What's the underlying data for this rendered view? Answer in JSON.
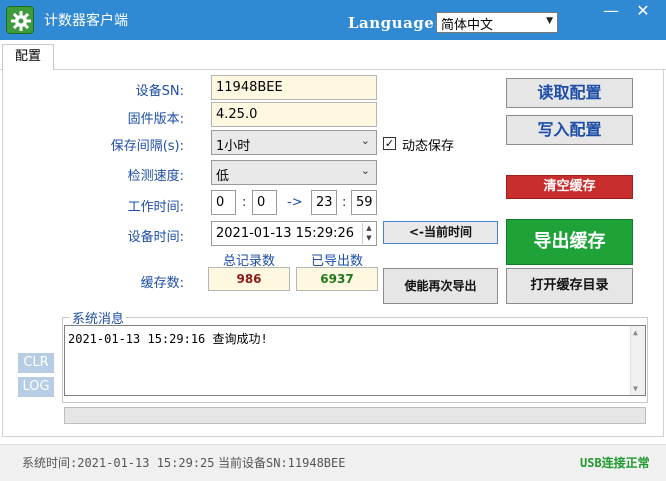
{
  "window": {
    "title": "计数器客户端",
    "language_label": "Language:",
    "language_value": "简体中文",
    "minimize": "—",
    "close": "✕"
  },
  "tabs": [
    {
      "label": "配置"
    }
  ],
  "form": {
    "sn_label": "设备SN:",
    "sn_value": "11948BEE",
    "fw_label": "固件版本:",
    "fw_value": "4.25.0",
    "interval_label": "保存间隔(s):",
    "interval_value": "1小时",
    "dynamic_save_label": "动态保存",
    "dynamic_save_checked": true,
    "speed_label": "检测速度:",
    "speed_value": "低",
    "worktime_label": "工作时间:",
    "work_start_h": "0",
    "work_start_m": "0",
    "work_end_h": "23",
    "work_end_m": "59",
    "colon": ":",
    "arrow": "->",
    "devtime_label": "设备时间:",
    "devtime_value": "2021-01-13 15:29:26",
    "current_time_button": "<-当前时间",
    "cache_label": "缓存数:",
    "total_header": "总记录数",
    "exported_header": "已导出数",
    "total_value": "986",
    "exported_value": "6937"
  },
  "buttons": {
    "read_config": "读取配置",
    "write_config": "写入配置",
    "clear_cache": "清空缓存",
    "export_cache": "导出缓存",
    "enable_reexport": "使能再次导出",
    "open_cache_dir": "打开缓存目录",
    "clr": "CLR",
    "log": "LOG"
  },
  "messages": {
    "title": "系统消息",
    "lines": [
      "2021-01-13 15:29:16 查询成功!"
    ]
  },
  "status": {
    "system_time": "系统时间:2021-01-13 15:29:25",
    "current_device": "当前设备SN:11948BEE",
    "usb": "USB连接正常"
  },
  "colors": {
    "titlebar": "#2f89d3",
    "label_blue": "#1e4ea8",
    "total_color": "#8b1a1a",
    "exported_color": "#1e7a1e",
    "usb_color": "#1f9a2e",
    "clear_red": "#c92e2e",
    "export_green": "#1fa238"
  },
  "icons": {
    "app": "gear-icon"
  }
}
